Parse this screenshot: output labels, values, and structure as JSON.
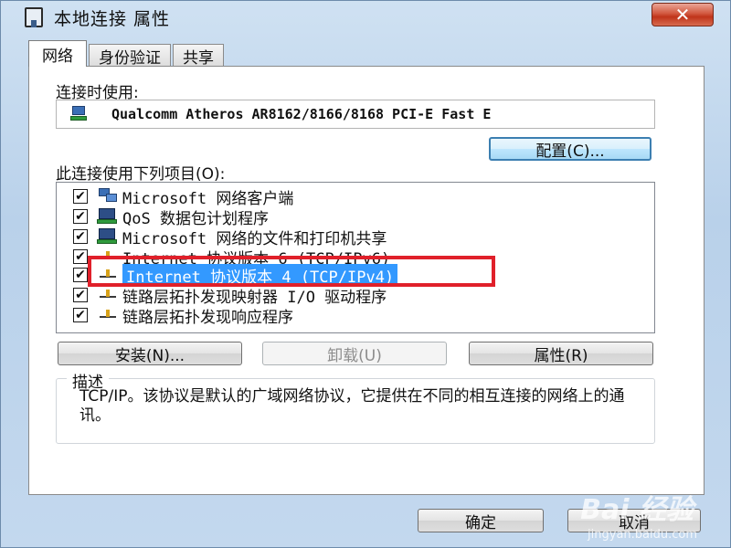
{
  "window": {
    "title": "本地连接 属性",
    "close_glyph": "✕"
  },
  "tabs": [
    {
      "label": "网络",
      "active": true
    },
    {
      "label": "身份验证",
      "active": false
    },
    {
      "label": "共享",
      "active": false
    }
  ],
  "connect_using": {
    "label": "连接时使用:",
    "adapter": "Qualcomm Atheros AR8162/8166/8168 PCI-E Fast E",
    "configure_button": "配置(C)..."
  },
  "items_section": {
    "label": "此连接使用下列项目(O):",
    "items": [
      {
        "checked": true,
        "icon": "network-client-icon",
        "label": "Microsoft 网络客户端",
        "selected": false
      },
      {
        "checked": true,
        "icon": "qos-scheduler-icon",
        "label": "QoS 数据包计划程序",
        "selected": false
      },
      {
        "checked": true,
        "icon": "file-printer-sharing-icon",
        "label": "Microsoft 网络的文件和打印机共享",
        "selected": false
      },
      {
        "checked": true,
        "icon": "protocol-icon",
        "label": "Internet 协议版本 6 (TCP/IPv6)",
        "selected": false
      },
      {
        "checked": true,
        "icon": "protocol-icon",
        "label": "Internet 协议版本 4 (TCP/IPv4)",
        "selected": true
      },
      {
        "checked": true,
        "icon": "protocol-icon",
        "label": "链路层拓扑发现映射器 I/O 驱动程序",
        "selected": false
      },
      {
        "checked": true,
        "icon": "protocol-icon",
        "label": "链路层拓扑发现响应程序",
        "selected": false
      }
    ],
    "check_glyph": "✔"
  },
  "buttons": {
    "install": "安装(N)...",
    "uninstall": "卸载(U)",
    "properties": "属性(R)",
    "ok": "确定",
    "cancel": "取消"
  },
  "description": {
    "legend": "描述",
    "text": "TCP/IP。该协议是默认的广域网络协议，它提供在不同的相互连接的网络上的通讯。"
  },
  "watermark": {
    "main": "Bai 经验",
    "sub": "jingyan.baidu.com"
  },
  "colors": {
    "highlight": "#3399ff",
    "annotation_box": "#e0202a",
    "close_button": "#c0341a"
  }
}
